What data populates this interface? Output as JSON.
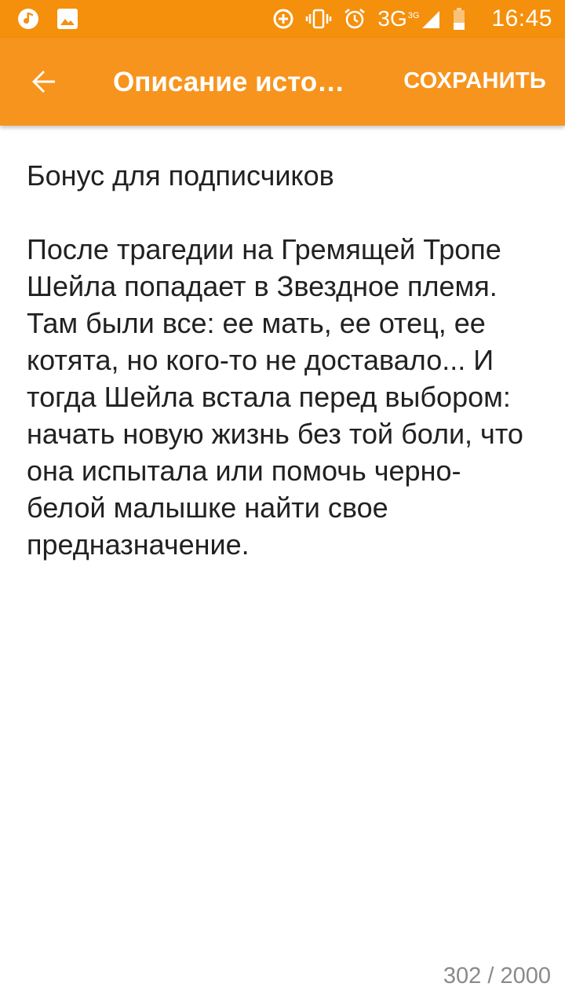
{
  "status_bar": {
    "time": "16:45",
    "network": "3G",
    "network_super": "3G",
    "icons": [
      "music-note-icon",
      "image-icon",
      "data-saver-icon",
      "vibrate-icon",
      "alarm-icon",
      "signal-icon",
      "battery-icon"
    ]
  },
  "app_bar": {
    "title": "Описание исто…",
    "save_label": "СОХРАНИТЬ",
    "back_icon": "arrow-back-icon"
  },
  "editor": {
    "text": "Бонус для подписчиков\n\nПосле трагедии на Гремящей Тропе Шейла попадает в Звездное племя. Там были все: ее мать, ее отец, ее котята, но кого-то не доставало... И тогда Шейла встала перед выбором: начать новую жизнь без той боли, что она испытала или помочь черно-белой малышке найти свое предназначение.",
    "counter": "302 / 2000"
  },
  "colors": {
    "status_bar": "#F4900C",
    "app_bar": "#F7941D",
    "text": "#212121",
    "counter": "#8a8a8a"
  }
}
